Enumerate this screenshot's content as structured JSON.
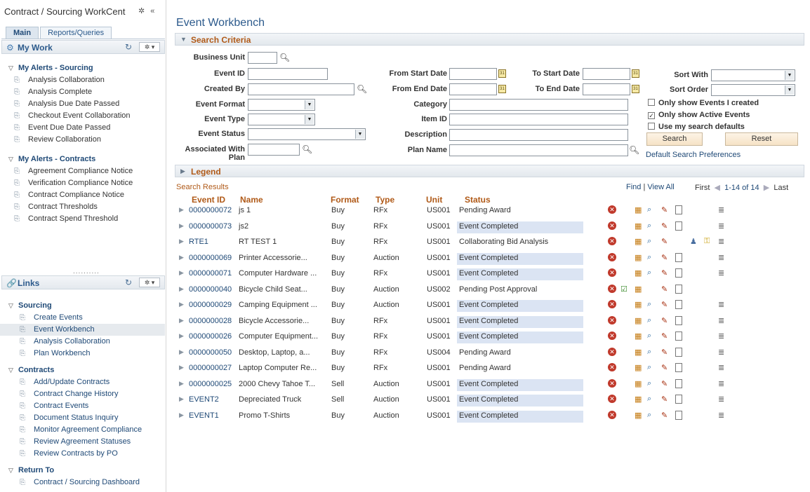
{
  "left": {
    "title": "Contract / Sourcing WorkCent",
    "tabs": [
      "Main",
      "Reports/Queries"
    ],
    "mywork": {
      "title": "My Work",
      "groups": [
        {
          "label": "My Alerts - Sourcing",
          "items": [
            "Analysis Collaboration",
            "Analysis Complete",
            "Analysis Due Date Passed",
            "Checkout Event Collaboration",
            "Event Due Date Passed",
            "Review Collaboration"
          ]
        },
        {
          "label": "My Alerts - Contracts",
          "items": [
            "Agreement Compliance Notice",
            "Verification Compliance Notice",
            "Contract Compliance Notice",
            "Contract Thresholds",
            "Contract Spend Threshold"
          ]
        }
      ]
    },
    "links": {
      "title": "Links",
      "groups": [
        {
          "label": "Sourcing",
          "items": [
            "Create Events",
            "Event Workbench",
            "Analysis Collaboration",
            "Plan Workbench"
          ]
        },
        {
          "label": "Contracts",
          "items": [
            "Add/Update Contracts",
            "Contract Change History",
            "Contract Events",
            "Document Status Inquiry",
            "Monitor Agreement Compliance",
            "Review Agreement Statuses",
            "Review Contracts by PO"
          ]
        },
        {
          "label": "Return To",
          "items": [
            "Contract / Sourcing Dashboard"
          ]
        }
      ],
      "selected": "Event Workbench"
    }
  },
  "main": {
    "title": "Event Workbench",
    "search_criteria": "Search Criteria",
    "labels": {
      "business_unit": "Business Unit",
      "event_id": "Event ID",
      "created_by": "Created By",
      "event_format": "Event Format",
      "event_type": "Event Type",
      "event_status": "Event Status",
      "associated_with": "Associated With",
      "plan": "Plan",
      "from_start_date": "From Start Date",
      "from_end_date": "From End Date",
      "to_start_date": "To Start Date",
      "to_end_date": "To End Date",
      "category": "Category",
      "item_id": "Item ID",
      "description": "Description",
      "plan_name": "Plan Name",
      "sort_with": "Sort With",
      "sort_order": "Sort Order"
    },
    "checkboxes": [
      {
        "label": "Only show Events I created",
        "checked": false
      },
      {
        "label": "Only show Active Events",
        "checked": true
      },
      {
        "label": "Use my search defaults",
        "checked": false
      }
    ],
    "search_button": "Search",
    "reset_button": "Reset",
    "default_prefs": "Default Search Preferences",
    "legend": "Legend",
    "results": {
      "title": "Search Results",
      "find": "Find",
      "view_all": "View All",
      "first": "First",
      "range": "1-14 of 14",
      "last": "Last",
      "columns": [
        "Event ID",
        "Name",
        "Format",
        "Type",
        "Unit",
        "Status"
      ],
      "rows": [
        {
          "id": "0000000072",
          "name": "js 1",
          "format": "Buy",
          "type": "RFx",
          "unit": "US001",
          "status": "Pending Award",
          "hl": false,
          "variant": "std"
        },
        {
          "id": "0000000073",
          "name": "js2",
          "format": "Buy",
          "type": "RFx",
          "unit": "US001",
          "status": "Event Completed",
          "hl": true,
          "variant": "std"
        },
        {
          "id": "RTE1",
          "name": "RT TEST 1",
          "format": "Buy",
          "type": "RFx",
          "unit": "US001",
          "status": "Collaborating Bid Analysis",
          "hl": false,
          "variant": "collab"
        },
        {
          "id": "0000000069",
          "name": "Printer Accessorie...",
          "format": "Buy",
          "type": "Auction",
          "unit": "US001",
          "status": "Event Completed",
          "hl": true,
          "variant": "std"
        },
        {
          "id": "0000000071",
          "name": "Computer Hardware ...",
          "format": "Buy",
          "type": "RFx",
          "unit": "US001",
          "status": "Event Completed",
          "hl": true,
          "variant": "std"
        },
        {
          "id": "0000000040",
          "name": "Bicycle Child Seat...",
          "format": "Buy",
          "type": "Auction",
          "unit": "US002",
          "status": "Pending Post Approval",
          "hl": false,
          "variant": "approve"
        },
        {
          "id": "0000000029",
          "name": "Camping Equipment ...",
          "format": "Buy",
          "type": "Auction",
          "unit": "US001",
          "status": "Event Completed",
          "hl": true,
          "variant": "std"
        },
        {
          "id": "0000000028",
          "name": "Bicycle Accessorie...",
          "format": "Buy",
          "type": "RFx",
          "unit": "US001",
          "status": "Event Completed",
          "hl": true,
          "variant": "std"
        },
        {
          "id": "0000000026",
          "name": "Computer Equipment...",
          "format": "Buy",
          "type": "RFx",
          "unit": "US001",
          "status": "Event Completed",
          "hl": true,
          "variant": "std"
        },
        {
          "id": "0000000050",
          "name": "Desktop, Laptop, a...",
          "format": "Buy",
          "type": "RFx",
          "unit": "US004",
          "status": "Pending Award",
          "hl": false,
          "variant": "std"
        },
        {
          "id": "0000000027",
          "name": "Laptop Computer Re...",
          "format": "Buy",
          "type": "RFx",
          "unit": "US001",
          "status": "Pending Award",
          "hl": false,
          "variant": "std"
        },
        {
          "id": "0000000025",
          "name": "2000 Chevy Tahoe T...",
          "format": "Sell",
          "type": "Auction",
          "unit": "US001",
          "status": "Event Completed",
          "hl": true,
          "variant": "std"
        },
        {
          "id": "EVENT2",
          "name": "Depreciated Truck",
          "format": "Sell",
          "type": "Auction",
          "unit": "US001",
          "status": "Event Completed",
          "hl": true,
          "variant": "std"
        },
        {
          "id": "EVENT1",
          "name": "Promo T-Shirts",
          "format": "Buy",
          "type": "Auction",
          "unit": "US001",
          "status": "Event Completed",
          "hl": true,
          "variant": "std"
        }
      ]
    }
  }
}
